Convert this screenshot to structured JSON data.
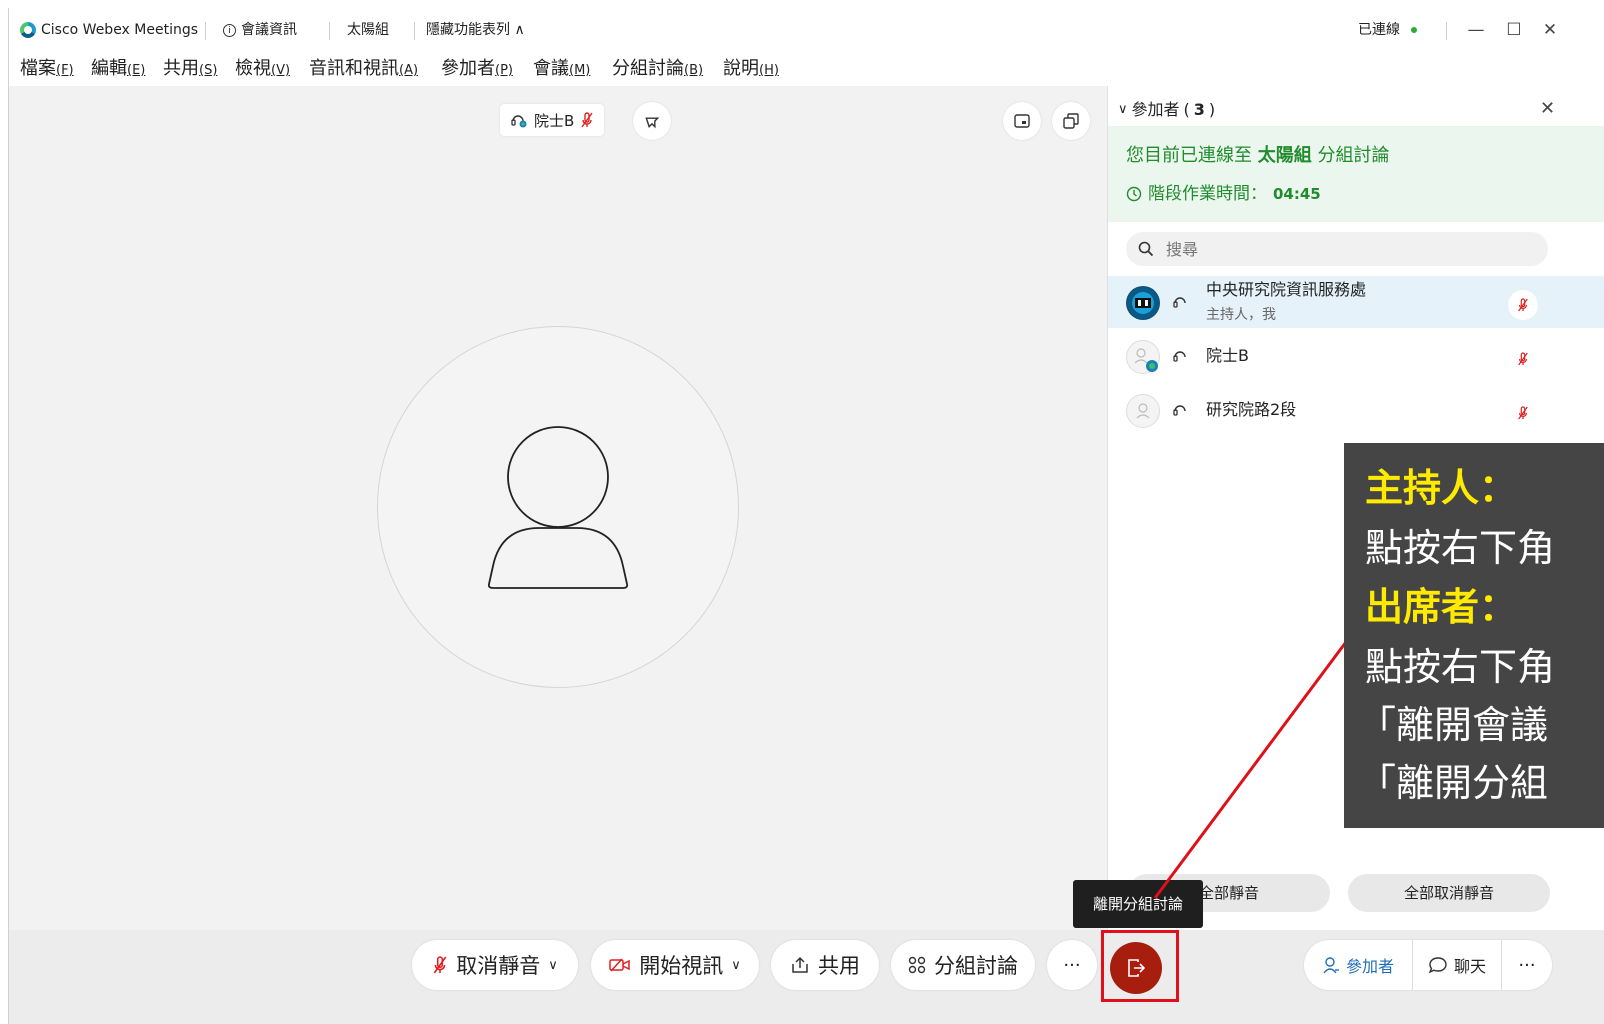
{
  "titlebar": {
    "app_name": "Cisco Webex Meetings",
    "meeting_info": "會議資訊",
    "group_name": "太陽組",
    "hide_menu": "隱藏功能表列 ∧",
    "status": "已連線"
  },
  "menu": [
    {
      "label": "檔案",
      "key": "(F)"
    },
    {
      "label": "編輯",
      "key": "(E)"
    },
    {
      "label": "共用",
      "key": "(S)"
    },
    {
      "label": "檢視",
      "key": "(V)"
    },
    {
      "label": "音訊和視訊",
      "key": "(A)"
    },
    {
      "label": "參加者",
      "key": "(P)"
    },
    {
      "label": "會議",
      "key": "(M)"
    },
    {
      "label": "分組討論",
      "key": "(B)"
    },
    {
      "label": "說明",
      "key": "(H)"
    }
  ],
  "stage": {
    "active_speaker": "院士B"
  },
  "panel": {
    "title": "參加者",
    "count": "3",
    "connected_prefix": "您目前已連線至",
    "connected_group": "太陽組",
    "connected_suffix": "分組討論",
    "timer_label": "階段作業時間：",
    "timer_value": "04:45",
    "search_placeholder": "搜尋",
    "participants": [
      {
        "name": "中央研究院資訊服務處",
        "role": "主持人，我"
      },
      {
        "name": "院士B",
        "role": ""
      },
      {
        "name": "研究院路2段",
        "role": ""
      }
    ],
    "mute_all": "全部靜音",
    "unmute_all": "全部取消靜音"
  },
  "controls": {
    "unmute": "取消靜音",
    "start_video": "開始視訊",
    "share": "共用",
    "breakout": "分組討論",
    "more": "···",
    "participants": "參加者",
    "chat": "聊天",
    "more_right": "···",
    "leave_tooltip": "離開分組討論"
  },
  "overlay": {
    "host_title": "主持人：",
    "host_text": "點按右下角",
    "attendee_title": "出席者：",
    "attendee_text": "點按右下角",
    "option1": "「離開會議",
    "option2": "「離開分組"
  }
}
